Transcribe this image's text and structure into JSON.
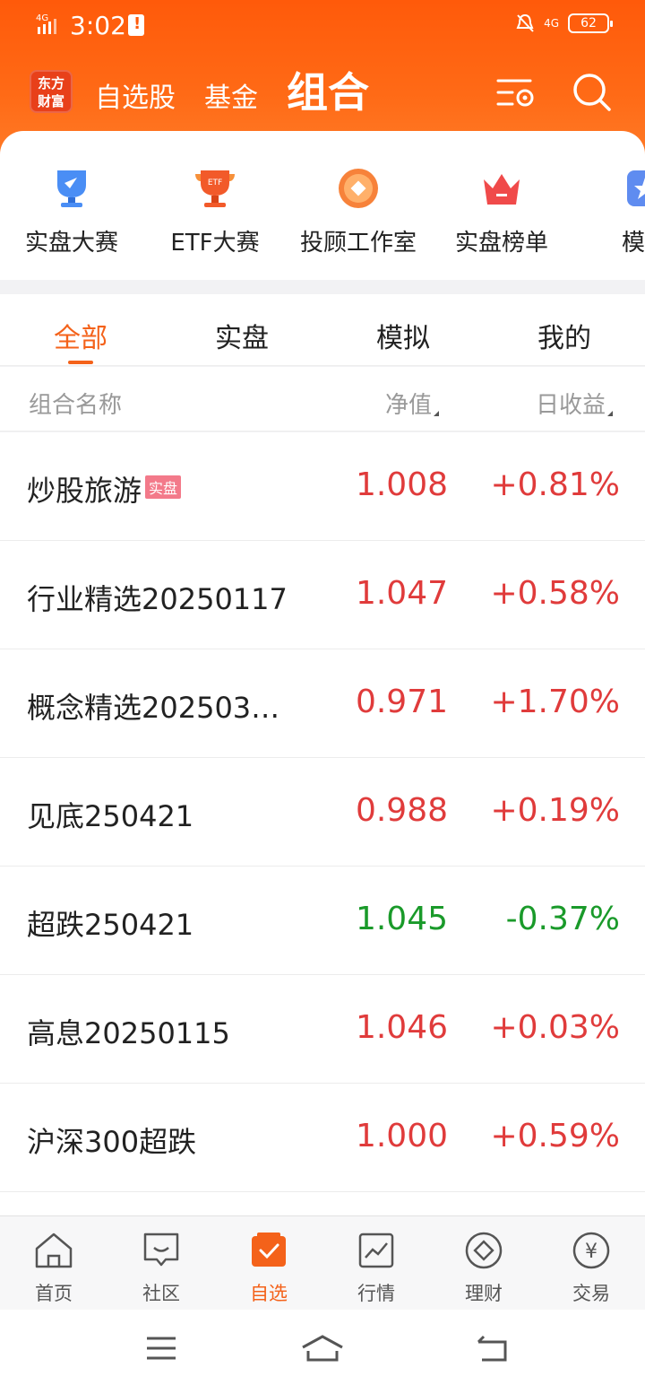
{
  "status_bar": {
    "time": "3:02",
    "network_left": "4G",
    "network_right": "4G",
    "battery": "62"
  },
  "header": {
    "logo_line1": "东方",
    "logo_line2": "财富",
    "nav": [
      {
        "label": "自选股"
      },
      {
        "label": "基金"
      },
      {
        "label": "组合",
        "active": true
      }
    ]
  },
  "shortcuts": [
    {
      "label": "实盘大赛",
      "icon": "trophy-blue-icon"
    },
    {
      "label": "ETF大赛",
      "icon": "trophy-etf-icon"
    },
    {
      "label": "投顾工作室",
      "icon": "advisor-icon"
    },
    {
      "label": "实盘榜单",
      "icon": "crown-icon"
    },
    {
      "label": "模拟",
      "icon": "star-icon"
    }
  ],
  "tabs": [
    {
      "label": "全部",
      "active": true
    },
    {
      "label": "实盘"
    },
    {
      "label": "模拟"
    },
    {
      "label": "我的"
    }
  ],
  "columns": {
    "name": "组合名称",
    "nav": "净值",
    "return": "日收益"
  },
  "portfolios": [
    {
      "name": "炒股旅游",
      "badge": "实盘",
      "nav": "1.008",
      "return": "+0.81%",
      "dir": "up"
    },
    {
      "name": "行业精选20250117",
      "badge": "",
      "nav": "1.047",
      "return": "+0.58%",
      "dir": "up"
    },
    {
      "name": "概念精选202503…",
      "badge": "",
      "nav": "0.971",
      "return": "+1.70%",
      "dir": "up"
    },
    {
      "name": "见底250421",
      "badge": "",
      "nav": "0.988",
      "return": "+0.19%",
      "dir": "up"
    },
    {
      "name": "超跌250421",
      "badge": "",
      "nav": "1.045",
      "return": "-0.37%",
      "dir": "down"
    },
    {
      "name": "高息20250115",
      "badge": "",
      "nav": "1.046",
      "return": "+0.03%",
      "dir": "up"
    },
    {
      "name": "沪深300超跌",
      "badge": "",
      "nav": "1.000",
      "return": "+0.59%",
      "dir": "up"
    }
  ],
  "bottom_nav": [
    {
      "label": "首页",
      "icon": "home-icon"
    },
    {
      "label": "社区",
      "icon": "community-icon"
    },
    {
      "label": "自选",
      "icon": "watchlist-icon",
      "active": true
    },
    {
      "label": "行情",
      "icon": "market-icon"
    },
    {
      "label": "理财",
      "icon": "wealth-icon"
    },
    {
      "label": "交易",
      "icon": "trade-icon"
    }
  ],
  "colors": {
    "accent": "#f4621a",
    "up": "#e03b3b",
    "down": "#1a9a2a",
    "header": "#ff5a0a"
  }
}
